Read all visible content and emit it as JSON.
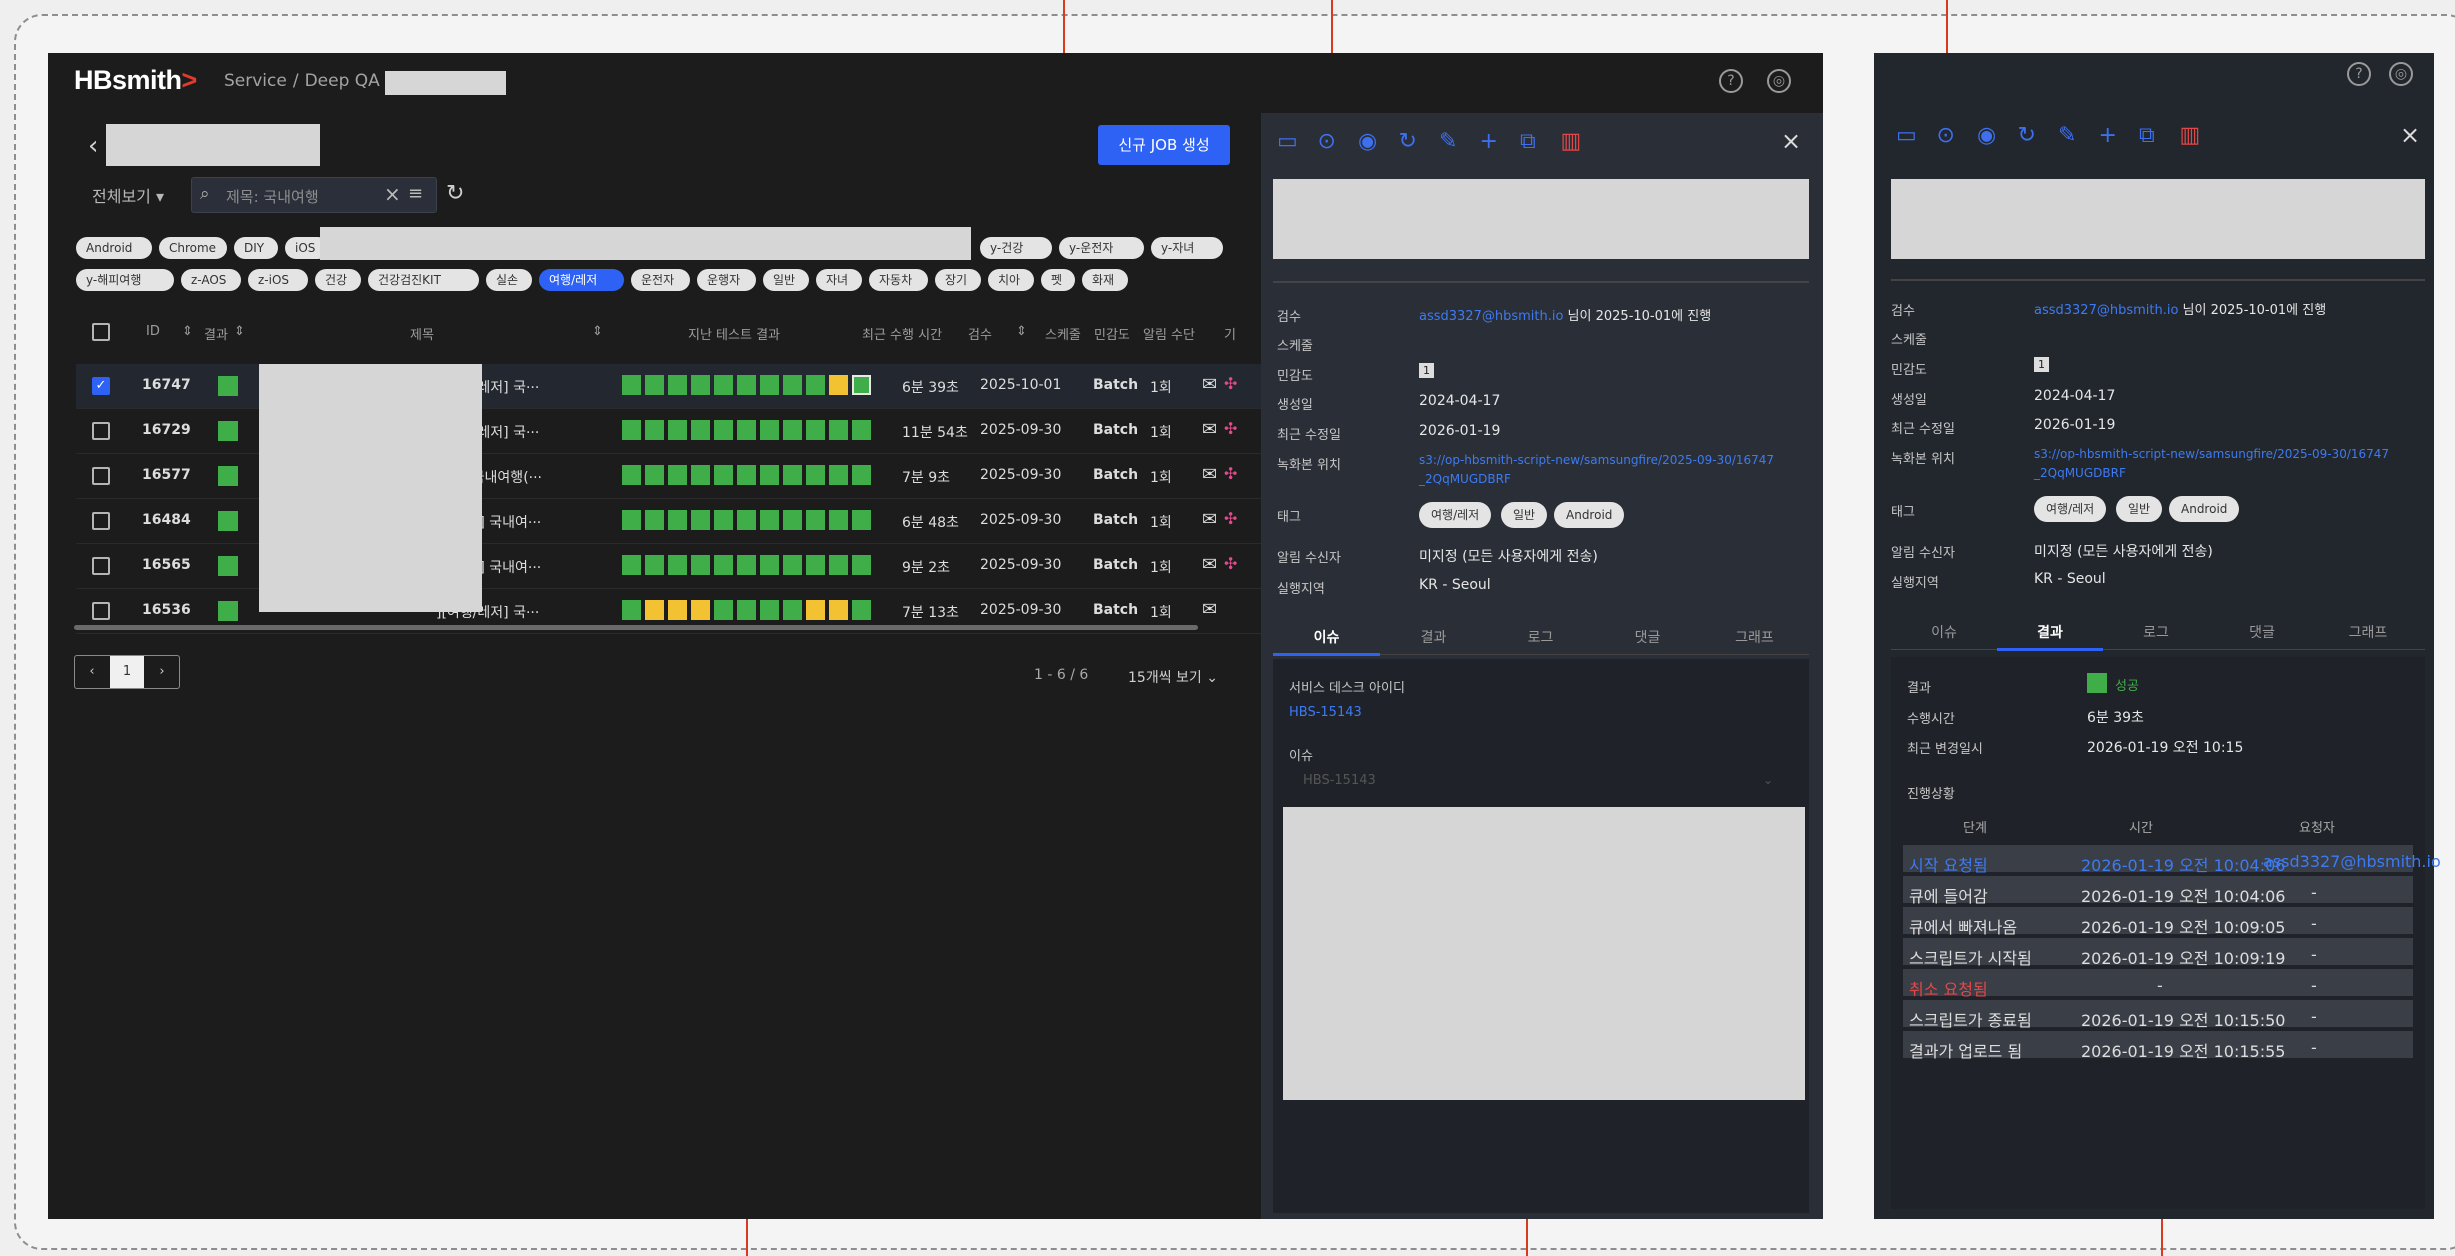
{
  "app": {
    "logo_main": "HBsmith",
    "logo_mark": ">",
    "breadcrumb": [
      "Service",
      "/",
      "Deep QA",
      "/"
    ],
    "new_job_label": "신규 JOB 생성",
    "view_all_label": "전체보기 ▾",
    "search_placeholder": "제목: 국내여행",
    "help_icon": "?",
    "user_icon": "◎"
  },
  "tags_row1": [
    "Android",
    "Chrome",
    "DIY",
    "iOS"
  ],
  "tags_row1_right": [
    "y-건강",
    "y-운전자",
    "y-자녀"
  ],
  "tags_row2": [
    "y-해피여행",
    "z-AOS",
    "z-iOS",
    "건강",
    "건강검진KIT",
    "실손",
    "여행/레저",
    "운전자",
    "운행자",
    "일반",
    "자녀",
    "자동차",
    "장기",
    "치아",
    "펫",
    "화재"
  ],
  "selected_tag": "여행/레저",
  "table": {
    "headers": [
      "ID",
      "결과",
      "제목",
      "지난 테스트 결과",
      "최근 수행 시간",
      "검수",
      "스케줄",
      "민감도",
      "알림 수단",
      "기"
    ],
    "rows": [
      {
        "id": "16747",
        "title": "][여행/레저] 국···",
        "hist": "gggggggggyo",
        "duration": "6분 39초",
        "date": "2025-10-01",
        "schedule": "Batch",
        "count": "1회",
        "checked": true
      },
      {
        "id": "16729",
        "title": "][여행/레저] 국···",
        "hist": "ggggggggggg",
        "duration": "11분 54초",
        "date": "2025-09-30",
        "schedule": "Batch",
        "count": "1회",
        "checked": false
      },
      {
        "id": "16577",
        "title": "레저] 국내여행(···",
        "hist": "ggggggggggg",
        "duration": "7분 9초",
        "date": "2025-09-30",
        "schedule": "Batch",
        "count": "1회",
        "checked": false
      },
      {
        "id": "16484",
        "title": "행/레저] 국내여···",
        "hist": "ggggggggggg",
        "duration": "6분 48초",
        "date": "2025-09-30",
        "schedule": "Batch",
        "count": "1회",
        "checked": false
      },
      {
        "id": "16565",
        "title": "행/레저] 국내여···",
        "hist": "ggggggggggg",
        "duration": "9분 2초",
        "date": "2025-09-30",
        "schedule": "Batch",
        "count": "1회",
        "checked": false
      },
      {
        "id": "16536",
        "title": "][여행/레저] 국···",
        "hist": "gyyyggggyyg",
        "duration": "7분 13초",
        "date": "2025-09-30",
        "schedule": "Batch",
        "count": "1회",
        "checked": false
      }
    ]
  },
  "pager": {
    "prev": "‹",
    "page": "1",
    "next": "›",
    "info": "1 - 6 / 6",
    "size": "15개씩 보기 ⌄"
  },
  "detail": {
    "labels": [
      "검수",
      "스케줄",
      "민감도",
      "생성일",
      "최근 수정일",
      "녹화본 위치",
      "태그",
      "알림 수신자",
      "실행지역"
    ],
    "reviewer": "assd3327@hbsmith.io",
    "reviewer_suffix": " 님이 2025-10-01에 진행",
    "sensitivity": "1",
    "created": "2024-04-17",
    "modified": "2026-01-19",
    "record_path_1": "s3://op-hbsmith-script-new/samsungfire/2025-09-30/16747",
    "record_path_2": "_2QqMUGDBRF",
    "tags": [
      "여행/레저",
      "일반",
      "Android"
    ],
    "receiver": "미지정 (모든 사용자에게 전송)",
    "region": "KR - Seoul",
    "tabs": [
      "이슈",
      "결과",
      "로그",
      "댓글",
      "그래프"
    ],
    "issue_label": "서비스 데스크 아이디",
    "issue_id": "HBS-15143",
    "issue_sub": "이슈",
    "issue_select": "HBS-15143"
  },
  "result": {
    "result_label": "결과",
    "result_value": "성공",
    "duration_label": "수행시간",
    "duration_value": "6분 39초",
    "changed_label": "최근 변경일시",
    "changed_value": "2026-01-19 오전 10:15",
    "progress_label": "진행상황",
    "cols": [
      "단계",
      "시간",
      "요청자"
    ],
    "steps": [
      {
        "step": "시작 요청됨",
        "time": "2026-01-19 오전 10:04:06",
        "who": "assd3327@hbsmith.io",
        "kind": "blue"
      },
      {
        "step": "큐에 들어감",
        "time": "2026-01-19 오전 10:04:06",
        "who": "-",
        "kind": "normal"
      },
      {
        "step": "큐에서 빠져나옴",
        "time": "2026-01-19 오전 10:09:05",
        "who": "-",
        "kind": "normal"
      },
      {
        "step": "스크립트가 시작됨",
        "time": "2026-01-19 오전 10:09:19",
        "who": "-",
        "kind": "normal"
      },
      {
        "step": "취소 요청됨",
        "time": "-",
        "who": "-",
        "kind": "red"
      },
      {
        "step": "스크립트가 종료됨",
        "time": "2026-01-19 오전 10:15:50",
        "who": "-",
        "kind": "normal"
      },
      {
        "step": "결과가 업로드 됨",
        "time": "2026-01-19 오전 10:15:55",
        "who": "-",
        "kind": "normal"
      }
    ]
  },
  "toolbar_icons": [
    "window-icon",
    "play-icon",
    "stop-icon",
    "refresh-icon",
    "edit-icon",
    "add-icon",
    "copy-icon",
    "delete-icon"
  ],
  "colors": {
    "accent": "#2d62f5",
    "success": "#3fae49",
    "warn": "#f2c233",
    "annotation": "#d93a1e"
  }
}
